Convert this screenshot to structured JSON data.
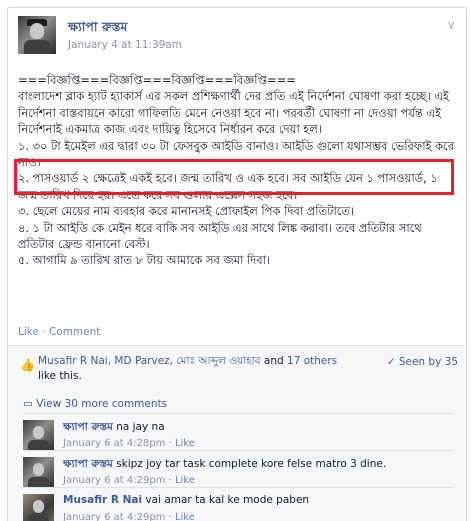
{
  "post": {
    "author": "ক্ষ্যাপা রুস্তম",
    "time": "January 4 at 11:39am",
    "chevron": "∨",
    "body_lines": [
      "===বিজ্ঞপ্তি===বিজ্ঞপ্তি===বিজ্ঞপ্তি===বিজ্ঞপ্তি===",
      "বাংলাদেশ ব্লাক হ্যাট হ্যাকার্স এর সকল প্রশিক্ষণার্থী দের প্রতি এই নির্দেশনা ঘোষণা করা হচ্ছে। এই নির্দেশনা বাস্তবায়নে কারো গাফিলতি মেনে নেওয়া হবে না। পরবর্তী ঘোষণা না দেওয়া পর্যন্ত এই নির্দেশনাই একমাত্র কাজ এবং দায়িত্ব হিসেবে নির্ধারন করে দেয়া হল।",
      "১. ৩০ টা ইমেইল এর দ্বারা ৩০ টা ফেসবুক আইডি বানাও। আইডি গুলো যথাসম্ভব ভেরিফাই করে নাও।",
      "২. পাসওয়ার্ড ২ ক্ষেত্রেই একই হবে। জন্ম তারিখ ও এক হবে। সব আইডি যেন ১ পাসওয়ার্ড, ১ জন্ম তারিখ দিয়ে হয়। এতে করে সব গুলায় এক্সেস সহজ হবে।",
      "৩. ছেলে মেয়ের নাম ব্যবহার করে মানানসই প্রোফাইল পিক দিবা প্রতিটাতে।",
      "৪. ১ টা আইডি কে মেইন ধরে বাকি সব আইডি এর সাথে লিঙ্ক করাবা। তবে প্রতিটার সাথে প্রতিটার ফ্রেন্ড বানানো বেস্ট।",
      "৫. আগামি ৯ তারিখ রাত ৮ টায় আমাকে সব জমা দিবা।"
    ],
    "actions": {
      "like": "Like",
      "separator": " · ",
      "comment": "Comment"
    }
  },
  "likes": {
    "thumb_icon": "thumbs-up-icon",
    "names": "Musafir R Nai, MD Parvez, মোঃ আব্দুল ওয়াহাব",
    "and_text": " and ",
    "others": "17 others",
    "suffix": " like this.",
    "seen": "✓ Seen by 35"
  },
  "comments": {
    "view_more": "▭ View 30 more comments",
    "items": [
      {
        "name": "ক্ষ্যাপা রুস্তম",
        "text": " na jay na",
        "time": "January 6 at 4:28pm",
        "sep": " · ",
        "like": "Like"
      },
      {
        "name": "ক্ষ্যাপা রুস্তম",
        "text": " skipz joy tar task complete kore felse matro 3 dine.",
        "time": "January 6 at 4:29pm",
        "sep": " · ",
        "like": "Like"
      },
      {
        "name": "Musafir R Nai",
        "text": " vai amar ta kal ke mode paben",
        "time": "January 6 at 4:29pm",
        "sep": " · ",
        "like": "Like"
      }
    ]
  }
}
